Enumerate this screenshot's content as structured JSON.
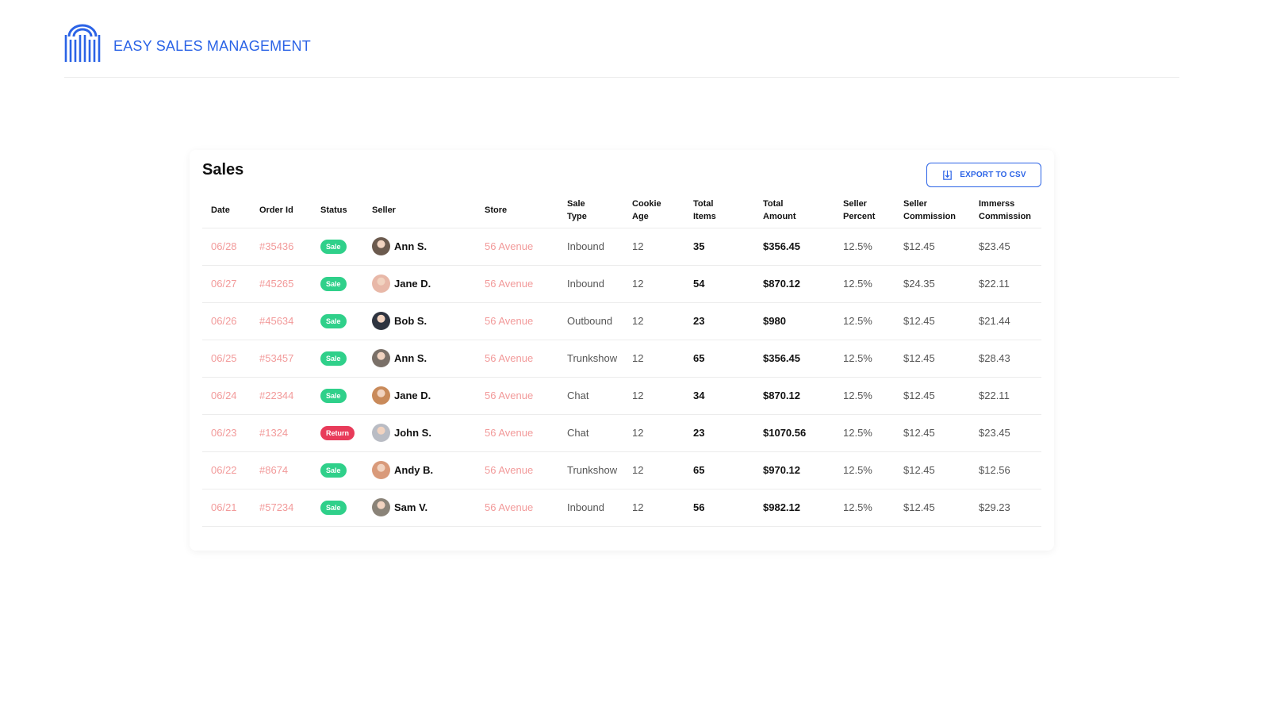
{
  "brand": {
    "name": "EASY SALES MANAGEMENT",
    "icon": "barcode-arch-logo-icon",
    "color": "#2b63e6"
  },
  "sales": {
    "title": "Sales",
    "export_label": "EXPORT TO CSV",
    "export_icon": "download-file-icon",
    "columns": [
      [
        "Date"
      ],
      [
        "Order Id"
      ],
      [
        "Status"
      ],
      [
        "Seller"
      ],
      [
        "Store"
      ],
      [
        "Sale",
        "Type"
      ],
      [
        "Cookie",
        "Age"
      ],
      [
        "Total",
        "Items"
      ],
      [
        "Total",
        "Amount"
      ],
      [
        "Seller",
        "Percent"
      ],
      [
        "Seller",
        "Commission"
      ],
      [
        "Immerss",
        "Commission"
      ]
    ],
    "status_colors": {
      "Sale": "#2fd08a",
      "Return": "#e83b5a"
    },
    "rows": [
      {
        "date": "06/28",
        "order": "#35436",
        "status": "Sale",
        "seller": "Ann S.",
        "avatar": "#6b5a4e",
        "store": "56 Avenue",
        "type": "Inbound",
        "cookie": "12",
        "items": "35",
        "amount": "$356.45",
        "pct": "12.5%",
        "scomm": "$12.45",
        "icomm": "$23.45"
      },
      {
        "date": "06/27",
        "order": "#45265",
        "status": "Sale",
        "seller": "Jane D.",
        "avatar": "#e8b8a8",
        "store": "56 Avenue",
        "type": "Inbound",
        "cookie": "12",
        "items": "54",
        "amount": "$870.12",
        "pct": "12.5%",
        "scomm": "$24.35",
        "icomm": "$22.11"
      },
      {
        "date": "06/26",
        "order": "#45634",
        "status": "Sale",
        "seller": "Bob S.",
        "avatar": "#2e3440",
        "store": "56 Avenue",
        "type": "Outbound",
        "cookie": "12",
        "items": "23",
        "amount": "$980",
        "pct": "12.5%",
        "scomm": "$12.45",
        "icomm": "$21.44"
      },
      {
        "date": "06/25",
        "order": "#53457",
        "status": "Sale",
        "seller": "Ann S.",
        "avatar": "#7a7068",
        "store": "56 Avenue",
        "type": "Trunkshow",
        "cookie": "12",
        "items": "65",
        "amount": "$356.45",
        "pct": "12.5%",
        "scomm": "$12.45",
        "icomm": "$28.43"
      },
      {
        "date": "06/24",
        "order": "#22344",
        "status": "Sale",
        "seller": "Jane D.",
        "avatar": "#c98a5a",
        "store": "56 Avenue",
        "type": "Chat",
        "cookie": "12",
        "items": "34",
        "amount": "$870.12",
        "pct": "12.5%",
        "scomm": "$12.45",
        "icomm": "$22.11"
      },
      {
        "date": "06/23",
        "order": "#1324",
        "status": "Return",
        "seller": "John S.",
        "avatar": "#b9bcc4",
        "store": "56 Avenue",
        "type": "Chat",
        "cookie": "12",
        "items": "23",
        "amount": "$1070.56",
        "pct": "12.5%",
        "scomm": "$12.45",
        "icomm": "$23.45"
      },
      {
        "date": "06/22",
        "order": "#8674",
        "status": "Sale",
        "seller": "Andy B.",
        "avatar": "#d99a7a",
        "store": "56 Avenue",
        "type": "Trunkshow",
        "cookie": "12",
        "items": "65",
        "amount": "$970.12",
        "pct": "12.5%",
        "scomm": "$12.45",
        "icomm": "$12.56"
      },
      {
        "date": "06/21",
        "order": "#57234",
        "status": "Sale",
        "seller": "Sam V.",
        "avatar": "#8a8378",
        "store": "56 Avenue",
        "type": "Inbound",
        "cookie": "12",
        "items": "56",
        "amount": "$982.12",
        "pct": "12.5%",
        "scomm": "$12.45",
        "icomm": "$29.23"
      }
    ]
  }
}
